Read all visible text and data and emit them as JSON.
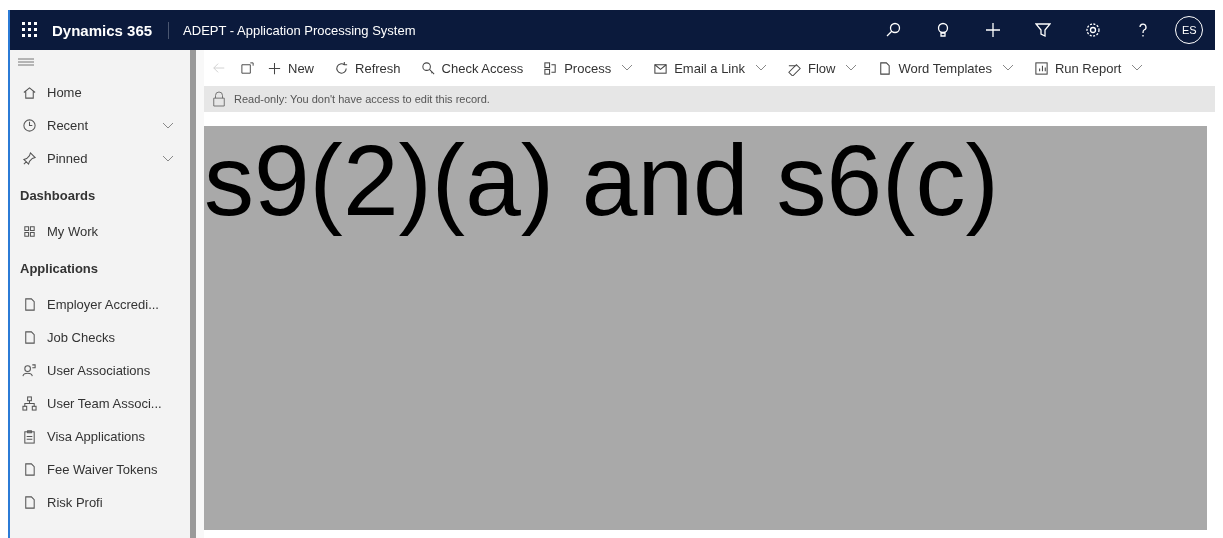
{
  "header": {
    "app_name": "Dynamics 365",
    "title": "ADEPT - Application Processing System",
    "avatar": "ES"
  },
  "commands": [
    {
      "label": "New",
      "has_menu": false
    },
    {
      "label": "Refresh",
      "has_menu": false
    },
    {
      "label": "Check Access",
      "has_menu": false
    },
    {
      "label": "Process",
      "has_menu": true
    },
    {
      "label": "Email a Link",
      "has_menu": true
    },
    {
      "label": "Flow",
      "has_menu": true
    },
    {
      "label": "Word Templates",
      "has_menu": true
    },
    {
      "label": "Run Report",
      "has_menu": true
    }
  ],
  "notice": "Read-only: You don't have access to edit this record.",
  "sidebar": [
    {
      "kind": "link",
      "label": "Home"
    },
    {
      "kind": "expandable",
      "label": "Recent",
      "expanded": false
    },
    {
      "kind": "expandable",
      "label": "Pinned",
      "expanded": false
    },
    {
      "kind": "heading",
      "label": "Dashboards"
    },
    {
      "kind": "link",
      "label": "My Work"
    },
    {
      "kind": "heading",
      "label": "Applications"
    },
    {
      "kind": "link",
      "label": "Employer Accredi..."
    },
    {
      "kind": "link",
      "label": "Job Checks"
    },
    {
      "kind": "link",
      "label": "User Associations"
    },
    {
      "kind": "link",
      "label": "User Team Associ..."
    },
    {
      "kind": "link",
      "label": "Visa Applications"
    },
    {
      "kind": "link",
      "label": "Fee Waiver Tokens"
    },
    {
      "kind": "link",
      "label": "Risk Profi"
    }
  ],
  "redaction": {
    "text": "s9(2)(a) and s6(c)"
  }
}
